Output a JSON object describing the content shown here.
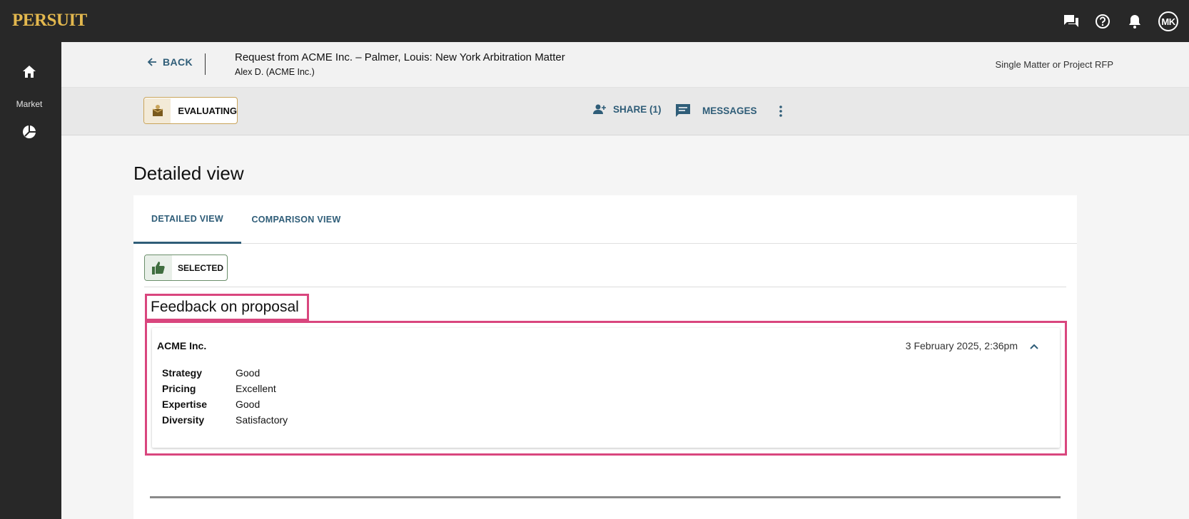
{
  "app": {
    "logo": "PERSUIT",
    "user_initials": "MK"
  },
  "topbar_icons": [
    "chat-icon",
    "help-icon",
    "bell-icon"
  ],
  "sidebar": {
    "items": [
      {
        "label": "",
        "icon": "home-icon"
      },
      {
        "label": "Market",
        "icon": "market-chart-icon"
      }
    ]
  },
  "header": {
    "back_label": "BACK",
    "title": "Request from ACME Inc. – Palmer, Louis: New York Arbitration Matter",
    "subtitle": "Alex D. (ACME Inc.)",
    "rfp_type": "Single Matter or Project RFP"
  },
  "subbar": {
    "status_label": "EVALUATING",
    "share_label": "SHARE (1)",
    "messages_label": "MESSAGES"
  },
  "page_title": "Detailed view",
  "tabs": [
    {
      "label": "DETAILED VIEW",
      "active": true
    },
    {
      "label": "COMPARISON VIEW",
      "active": false
    }
  ],
  "selection": {
    "label": "SELECTED"
  },
  "feedback": {
    "heading": "Feedback on proposal",
    "company": "ACME Inc.",
    "date": "3 February 2025, 2:36pm",
    "ratings": [
      {
        "criterion": "Strategy",
        "rating": "Good"
      },
      {
        "criterion": "Pricing",
        "rating": "Excellent"
      },
      {
        "criterion": "Expertise",
        "rating": "Good"
      },
      {
        "criterion": "Diversity",
        "rating": "Satisfactory"
      }
    ]
  },
  "colors": {
    "accent": "#2f5d78",
    "highlight": "#d9467e",
    "brand_gold": "#e3b84e",
    "chrome": "#282828"
  }
}
